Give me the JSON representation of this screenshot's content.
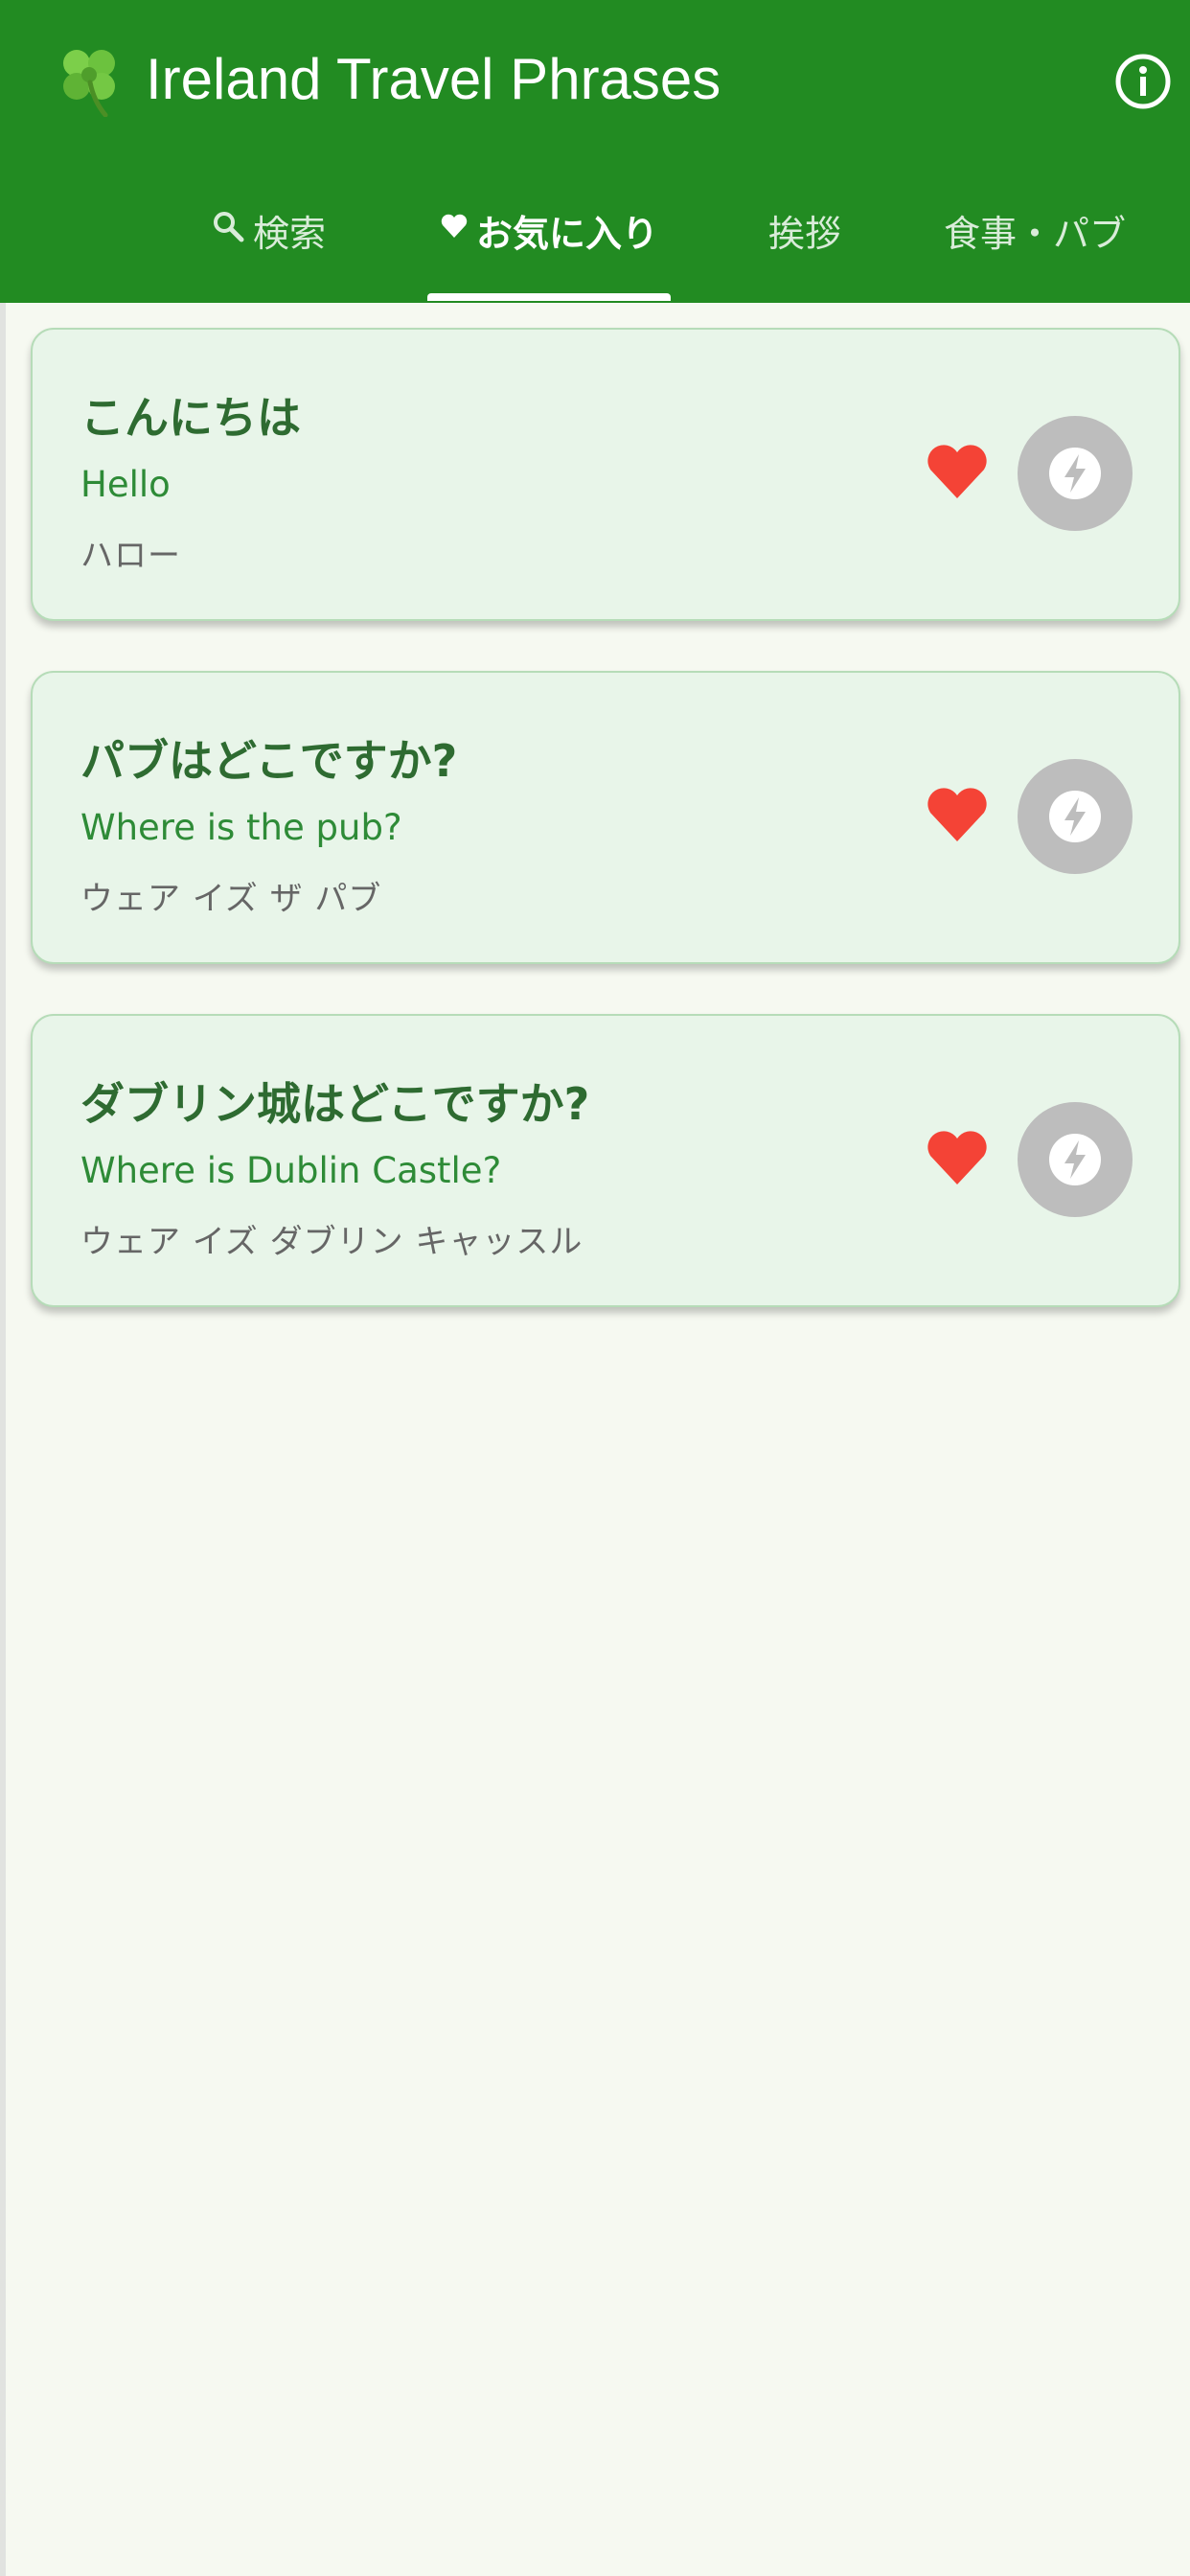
{
  "app": {
    "title": "Ireland Travel Phrases",
    "icons": {
      "logo": "shamrock-icon",
      "info": "info-icon"
    }
  },
  "tabs": [
    {
      "label": "検索",
      "icon": "search-icon",
      "active": false
    },
    {
      "label": "お気に入り",
      "icon": "heart-icon",
      "active": true
    },
    {
      "label": "挨拶",
      "active": false
    },
    {
      "label": "食事・パブ",
      "active": false
    }
  ],
  "phrases": [
    {
      "japanese": "こんにちは",
      "english": "Hello",
      "pronunciation": "ハロー",
      "favorite": true
    },
    {
      "japanese": "パブはどこですか?",
      "english": "Where is the pub?",
      "pronunciation": "ウェア イズ ザ パブ",
      "favorite": true
    },
    {
      "japanese": "ダブリン城はどこですか?",
      "english": "Where is Dublin Castle?",
      "pronunciation": "ウェア イズ ダブリン キャッスル",
      "favorite": true
    }
  ],
  "colors": {
    "header": "#228b22",
    "background": "#f6f9f1",
    "card": "#e8f5e9",
    "phrase_text": "#2e6b31",
    "translation_text": "#2e8b37",
    "pronunciation_text": "#666666",
    "heart": "#f44336",
    "flash_button": "#bdbdbd"
  }
}
